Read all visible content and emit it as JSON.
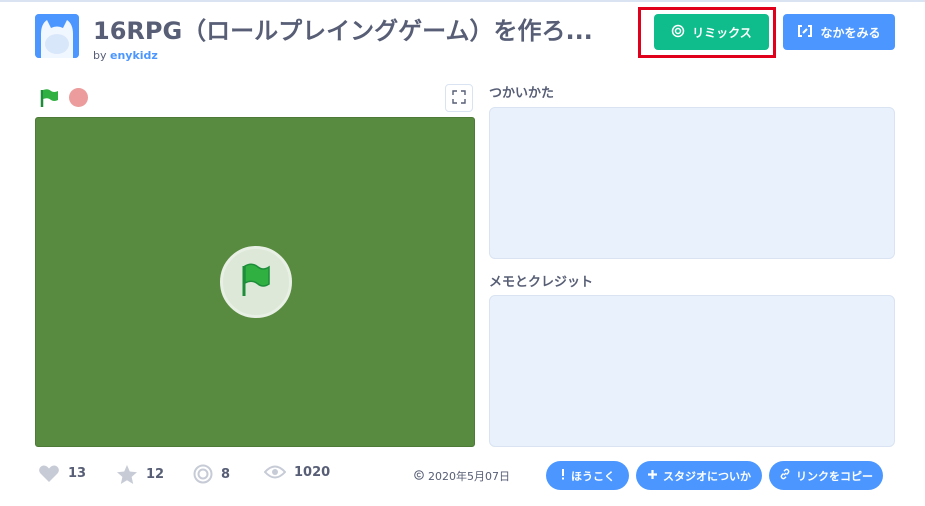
{
  "project": {
    "title": "16RPG（ロールプレイングゲーム）を作ろ...",
    "by_label": "by",
    "author": "enykidz"
  },
  "header_buttons": {
    "remix": {
      "label": "リミックス",
      "icon": "remix-swirl-icon",
      "color": "#0fbd8c"
    },
    "see_inside": {
      "label": "なかをみる",
      "icon": "see-inside-icon",
      "color": "#4c97ff"
    }
  },
  "player": {
    "controls": {
      "green_flag": "green-flag-icon",
      "stop": "stop-icon",
      "fullscreen": "fullscreen-icon"
    },
    "stage_color": "#588a3f",
    "overlay_icon": "green-flag-icon"
  },
  "sections": {
    "instructions_label": "つかいかた",
    "notes_label": "メモとクレジット"
  },
  "stats": {
    "loves": "13",
    "favorites": "12",
    "remixes": "8",
    "views": "1020"
  },
  "date": {
    "icon": "copyright-icon",
    "text": "2020年5月07日"
  },
  "actions": {
    "report": "ほうこく",
    "add_to_studio": "スタジオについか",
    "copy_link": "リンクをコピー"
  },
  "highlight_color": "#e0001b"
}
